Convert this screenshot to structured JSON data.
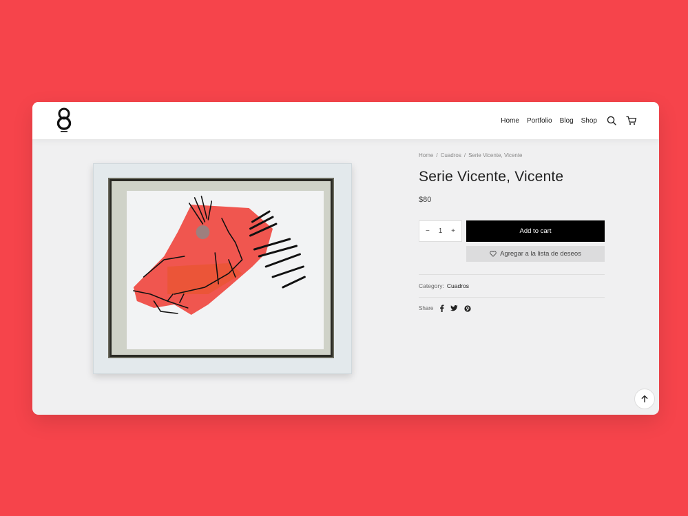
{
  "header": {
    "logo_name": "logo-8-icon",
    "nav": [
      {
        "label": "Home"
      },
      {
        "label": "Portfolio"
      },
      {
        "label": "Blog"
      },
      {
        "label": "Shop"
      }
    ],
    "search_icon": "search-icon",
    "cart_icon": "cart-icon"
  },
  "breadcrumb": {
    "items": [
      "Home",
      "Cuadros",
      "Serie Vicente, Vicente"
    ],
    "separator": "/"
  },
  "product": {
    "title": "Serie Vicente, Vicente",
    "price": "$80",
    "quantity": "1",
    "qty_minus": "−",
    "qty_plus": "+",
    "add_to_cart_label": "Add to cart",
    "wishlist_label": "Agregar a la lista de deseos",
    "category_label": "Category:",
    "category_value": "Cuadros",
    "share_label": "Share",
    "share_icons": [
      "facebook-icon",
      "twitter-icon",
      "pinterest-icon"
    ]
  },
  "colors": {
    "background": "#f6444b",
    "accent_button": "#000000",
    "sketch_red": "#f0453d"
  },
  "scroll_top_icon": "arrow-up-icon"
}
